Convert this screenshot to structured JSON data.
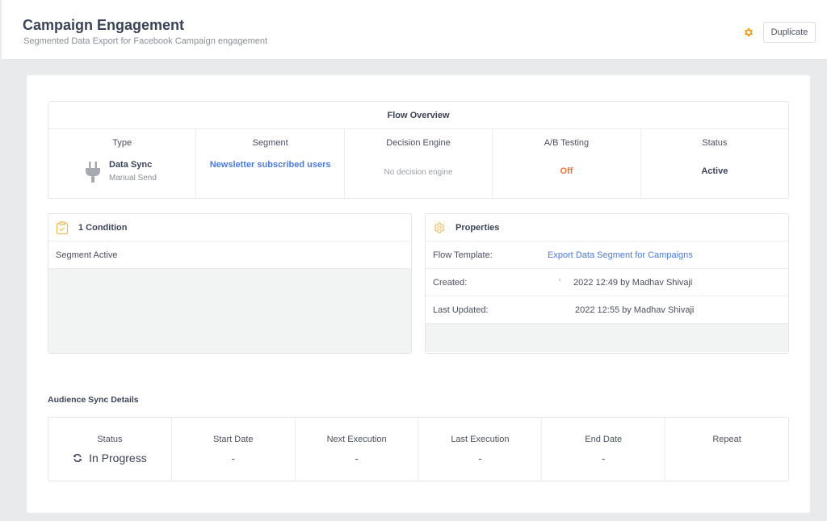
{
  "header": {
    "title": "Campaign Engagement",
    "subtitle": "Segmented Data Export for Facebook Campaign engagement",
    "settings_icon": "gear-icon",
    "duplicate_label": "Duplicate",
    "accent_color": "#f0a020"
  },
  "overview": {
    "title": "Flow Overview",
    "columns": [
      {
        "label": "Type",
        "value": "Data Sync",
        "sub": "Manual Send",
        "icon": "plug-icon"
      },
      {
        "label": "Segment",
        "value": "Newsletter subscribed users"
      },
      {
        "label": "Decision Engine",
        "value": "No decision engine"
      },
      {
        "label": "A/B Testing",
        "value": "Off"
      },
      {
        "label": "Status",
        "value": "Active"
      }
    ]
  },
  "conditions": {
    "title": "1 Condition",
    "icon": "clipboard-check-icon",
    "items": [
      "Segment Active"
    ]
  },
  "properties": {
    "title": "Properties",
    "icon": "gear-icon",
    "rows": [
      {
        "label": "Flow Template:",
        "value": "Export Data Segment for Campaigns"
      },
      {
        "label": "Created:",
        "prefix": "'",
        "value": "2022 12:49 by Madhav Shivaji"
      },
      {
        "label": "Last Updated:",
        "value": "2022 12:55 by Madhav Shivaji"
      }
    ]
  },
  "sync": {
    "title": "Audience Sync Details",
    "columns": [
      {
        "label": "Status",
        "value": "In Progress",
        "icon": "sync-icon"
      },
      {
        "label": "Start Date",
        "value": "-"
      },
      {
        "label": "Next Execution",
        "value": "-"
      },
      {
        "label": "Last Execution",
        "value": "-"
      },
      {
        "label": "End Date",
        "value": "-"
      },
      {
        "label": "Repeat",
        "value": ""
      }
    ]
  }
}
